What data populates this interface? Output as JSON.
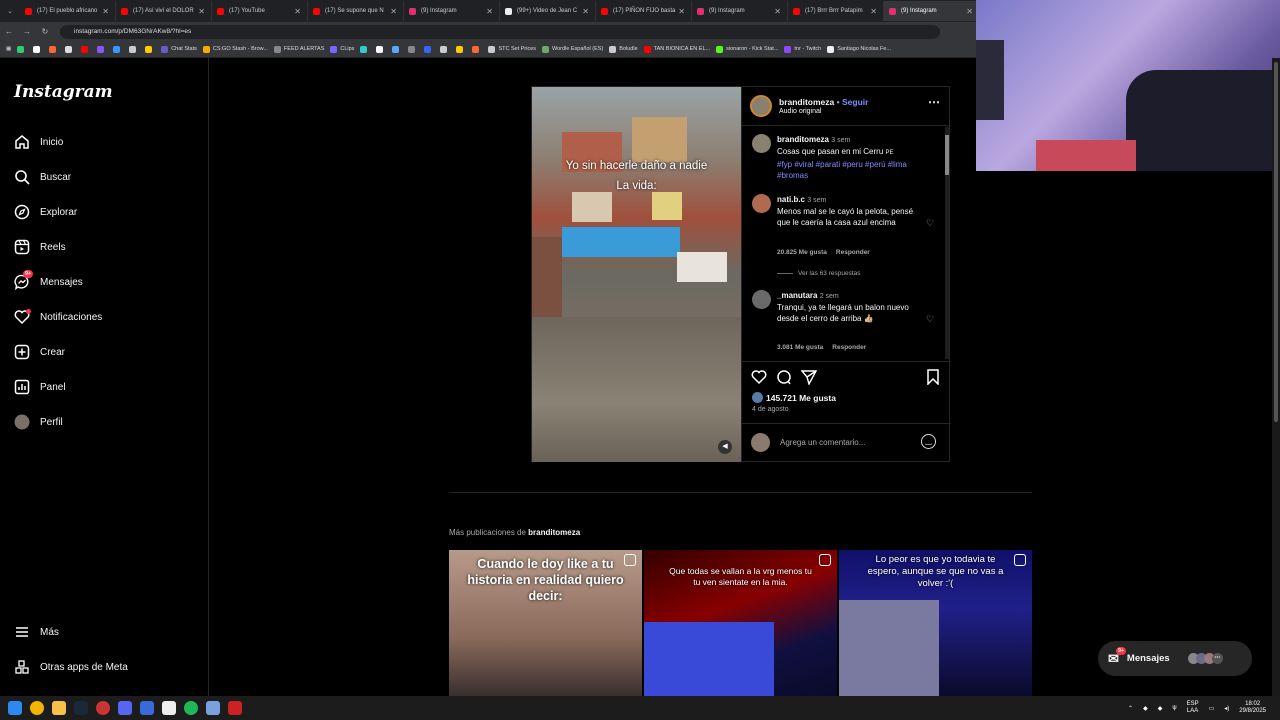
{
  "browser": {
    "tabs": [
      {
        "label": "(17) El pueblo africano",
        "icon": "youtube-icon",
        "color": "#ff0000"
      },
      {
        "label": "(17) Así viví el DOLOR",
        "icon": "youtube-icon",
        "color": "#ff0000"
      },
      {
        "label": "(17) YouTube",
        "icon": "youtube-icon",
        "color": "#ff0000"
      },
      {
        "label": "(17) Se supone que N",
        "icon": "youtube-icon",
        "color": "#ff0000"
      },
      {
        "label": "(9) Instagram",
        "icon": "instagram-icon",
        "color": "#e1306c"
      },
      {
        "label": "(99+) Video de Jean C",
        "icon": "tiktok-icon",
        "color": "#eeeeee"
      },
      {
        "label": "(17) PIÑON FIJO basta",
        "icon": "youtube-icon",
        "color": "#ff0000"
      },
      {
        "label": "(9) Instagram",
        "icon": "instagram-icon",
        "color": "#e1306c"
      },
      {
        "label": "(17) Brrr Brrr Patapim",
        "icon": "youtube-icon",
        "color": "#ff0000"
      },
      {
        "label": "(9) Instagram",
        "icon": "instagram-icon",
        "color": "#e1306c"
      }
    ],
    "url": "instagram.com/p/DM63GNrAKw8/?hl=es",
    "bookmarks": [
      {
        "label": "",
        "color": "#2ecc71"
      },
      {
        "label": "",
        "color": "#ffffff"
      },
      {
        "label": "",
        "color": "#ff6633"
      },
      {
        "label": "",
        "color": "#dddddd"
      },
      {
        "label": "",
        "color": "#ff0000"
      },
      {
        "label": "",
        "color": "#8855ff"
      },
      {
        "label": "",
        "color": "#3399ff"
      },
      {
        "label": "",
        "color": "#cccccc"
      },
      {
        "label": "",
        "color": "#ffcc00"
      },
      {
        "label": "Chat Stats",
        "color": "#6a5acd"
      },
      {
        "label": "CS:GO Stash - Brow...",
        "color": "#ffaa00"
      },
      {
        "label": "FEED ALERTAS",
        "color": "#888888"
      },
      {
        "label": "CLips",
        "color": "#7766ff"
      },
      {
        "label": "",
        "color": "#33cccc"
      },
      {
        "label": "",
        "color": "#ffffff"
      },
      {
        "label": "",
        "color": "#55aaff"
      },
      {
        "label": "",
        "color": "#888888"
      },
      {
        "label": "",
        "color": "#3366ff"
      },
      {
        "label": "",
        "color": "#cccccc"
      },
      {
        "label": "",
        "color": "#ffcc00"
      },
      {
        "label": "",
        "color": "#ff6633"
      },
      {
        "label": "STC Set Prices",
        "color": "#cccccc"
      },
      {
        "label": "Wordle Español (ES)",
        "color": "#6aaa64"
      },
      {
        "label": "Boludle",
        "color": "#cccccc"
      },
      {
        "label": "TAN BIONICA EN EL...",
        "color": "#ff0000"
      },
      {
        "label": "sionaron - Kick Stat...",
        "color": "#53fc18"
      },
      {
        "label": "tnr - Twitch",
        "color": "#9146ff"
      },
      {
        "label": "Santiago Nicolas Fe...",
        "color": "#eeeeee"
      }
    ]
  },
  "sidebar": {
    "logo": "Instagram",
    "items": [
      {
        "label": "Inicio",
        "icon": "home-icon"
      },
      {
        "label": "Buscar",
        "icon": "search-icon"
      },
      {
        "label": "Explorar",
        "icon": "compass-icon"
      },
      {
        "label": "Reels",
        "icon": "reels-icon"
      },
      {
        "label": "Mensajes",
        "icon": "messenger-icon",
        "badge": "9+"
      },
      {
        "label": "Notificaciones",
        "icon": "heart-icon"
      },
      {
        "label": "Crear",
        "icon": "plus-square-icon"
      },
      {
        "label": "Panel",
        "icon": "chart-icon"
      },
      {
        "label": "Perfil",
        "icon": "avatar-icon"
      }
    ],
    "bottom": [
      {
        "label": "Más",
        "icon": "menu-icon"
      },
      {
        "label": "Otras apps de Meta",
        "icon": "meta-apps-icon"
      }
    ]
  },
  "post": {
    "video_caption_1": "Yo sin hacerle daño a nadie",
    "video_caption_2": "La vida:",
    "author": "branditomeza",
    "follow": "Seguir",
    "separator": "•",
    "audio": "Audio original",
    "caption": {
      "user": "branditomeza",
      "time": "3 sem",
      "text": "Cosas que pasan en mi Cerru",
      "flag": "PE",
      "hashtags": "#fyp #viral #parati #peru #perú #lima #bromas"
    },
    "comments": [
      {
        "user": "nati.b.c",
        "time": "3 sem",
        "text": "Menos mal se le cayó la pelota, pensé que le caería la casa azul encima",
        "likes": "20.825 Me gusta",
        "reply": "Responder",
        "replies": "Ver las 63 respuestas"
      },
      {
        "user": "_manutara",
        "time": "2 sem",
        "text": "Tranqui, ya te llegará un balon nuevo desde el cerro de arriba",
        "emoji": "👍🏼",
        "likes": "3.081 Me gusta",
        "reply": "Responder"
      }
    ],
    "likes": "145.721 Me gusta",
    "date": "4 de agosto",
    "comment_placeholder": "Agrega un comentario..."
  },
  "more": {
    "prefix": "Más publicaciones de ",
    "user": "branditomeza",
    "thumbs": [
      {
        "text": "Cuando le doy like a tu historia en realidad quiero decir:"
      },
      {
        "text": "Que todas se vallan a la vrg menos tu tu ven sientate en la mia."
      },
      {
        "text": "Lo peor es que yo todavia te espero, aunque se que no vas a volver :'("
      }
    ]
  },
  "messages_bar": {
    "label": "Mensajes",
    "badge": "9+"
  },
  "taskbar": {
    "lang": "ESP",
    "lang2": "LAA",
    "time": "18:02",
    "date": "29/8/2025"
  }
}
